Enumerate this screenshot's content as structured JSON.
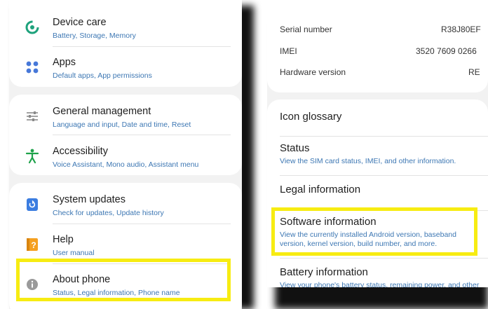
{
  "settings_list": {
    "items": [
      {
        "title": "Device care",
        "subtitle": "Battery, Storage, Memory",
        "icon": "device-care-icon",
        "icon_color": "#1ea27c"
      },
      {
        "title": "Apps",
        "subtitle": "Default apps, App permissions",
        "icon": "apps-icon",
        "icon_color": "#4778d9"
      },
      {
        "title": "General management",
        "subtitle": "Language and input, Date and time, Reset",
        "icon": "sliders-icon",
        "icon_color": "#8a8a8a"
      },
      {
        "title": "Accessibility",
        "subtitle": "Voice Assistant, Mono audio, Assistant menu",
        "icon": "accessibility-icon",
        "icon_color": "#1ea24a"
      },
      {
        "title": "System updates",
        "subtitle": "Check for updates, Update history",
        "icon": "system-update-icon",
        "icon_color": "#3b7de0"
      },
      {
        "title": "Help",
        "subtitle": "User manual",
        "icon": "help-icon",
        "icon_color": "#f5a020"
      },
      {
        "title": "About phone",
        "subtitle": "Status, Legal information, Phone name",
        "icon": "info-icon",
        "icon_color": "#8a8a8a"
      }
    ]
  },
  "about_phone": {
    "specs": [
      {
        "label": "Serial number",
        "value": "R38J80EF"
      },
      {
        "label": "IMEI",
        "value": "3520 7609 0266"
      },
      {
        "label": "Hardware version",
        "value": "RE"
      }
    ],
    "items": [
      {
        "title": "Icon glossary",
        "subtitle": ""
      },
      {
        "title": "Status",
        "subtitle": "View the SIM card status, IMEI, and other information."
      },
      {
        "title": "Legal information",
        "subtitle": ""
      },
      {
        "title": "Software information",
        "subtitle": "View the currently installed Android version, baseband version, kernel version, build number, and more."
      },
      {
        "title": "Battery information",
        "subtitle": "View your phone's battery status, remaining power, and other"
      }
    ]
  },
  "highlight_color": "#f7ec12"
}
